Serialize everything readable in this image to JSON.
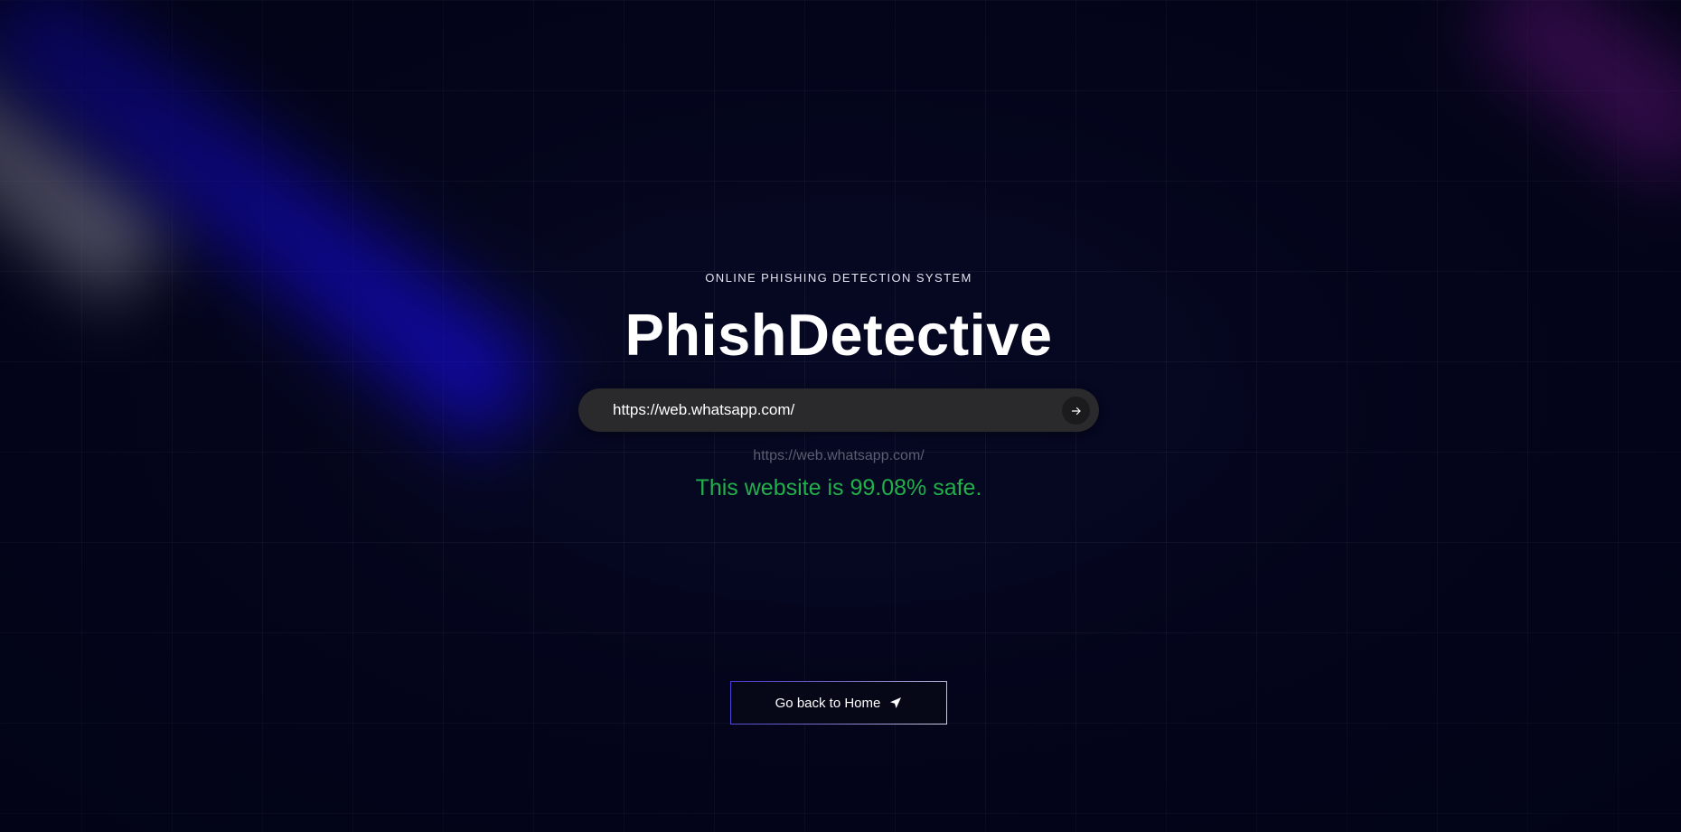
{
  "hero": {
    "eyebrow": "ONLINE PHISHING DETECTION SYSTEM",
    "title": "PhishDetective"
  },
  "search": {
    "value": "https://web.whatsapp.com/",
    "submit_icon": "arrow-right-icon"
  },
  "result": {
    "checked_url": "https://web.whatsapp.com/",
    "message": "This website is 99.08% safe.",
    "color": "#22b04b"
  },
  "actions": {
    "home_label": "Go back to Home",
    "home_icon": "send-arrow-icon"
  },
  "colors": {
    "background": "#03041a",
    "search_bar": "#2a2a2c",
    "beam_blue": "#140ad2",
    "beam_purple": "#aa1ec8"
  }
}
